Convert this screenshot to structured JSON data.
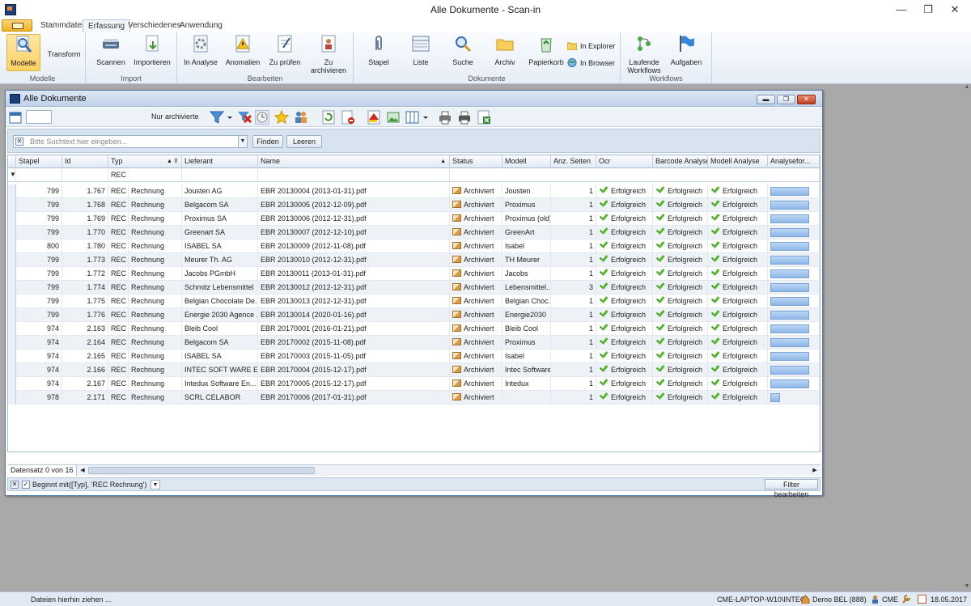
{
  "window": {
    "title": "Alle Dokumente - Scan-in",
    "minimize": "—",
    "restore": "❐",
    "close": "✕"
  },
  "tabs": [
    "Stammdaten",
    "Erfassung",
    "Verschiedenes",
    "Anwendung"
  ],
  "ribbon": {
    "groups": {
      "modelle": "Modelle",
      "import": "Import",
      "bearbeiten": "Bearbeiten",
      "dokumente": "Dokumente",
      "workflows": "Workflows"
    },
    "buttons": {
      "modelle": "Modelle",
      "transform": "Transform",
      "scannen": "Scannen",
      "importieren": "Importieren",
      "in_analyse": "In Analyse",
      "anomalien": "Anomalien",
      "zu_pruefen": "Zu prüfen",
      "zu_archivieren_1": "Zu",
      "zu_archivieren_2": "archivieren",
      "stapel": "Stapel",
      "liste": "Liste",
      "suche": "Suche",
      "archiv": "Archiv",
      "papierkorb": "Papierkorb",
      "in_explorer": "In Explorer",
      "in_browser": "In Browser",
      "laufende_1": "Laufende",
      "laufende_2": "Workflows",
      "aufgaben": "Aufgaben"
    }
  },
  "mdi": {
    "title": "Alle Dokumente"
  },
  "toolbar": {
    "nur_archivierte": "Nur archivierte"
  },
  "search": {
    "placeholder": "Bitte Suchtext hier eingeben...",
    "finden": "Finden",
    "leeren": "Leeren"
  },
  "grid": {
    "columns": [
      "Stapel",
      "Id",
      "Typ",
      "Lieferant",
      "Name",
      "Status",
      "Modell",
      "Anz. Seiten",
      "Ocr",
      "Barcode Analyse",
      "Modell Analyse",
      "Analysefor..."
    ],
    "filter_typ": "REC",
    "rows": [
      {
        "stapel": "799",
        "id": "1.767",
        "typ": "REC",
        "sub": "Rechnung",
        "lieferant": "Jousten AG",
        "name": "EBR 20130004 (2013-01-31).pdf",
        "status": "Archiviert",
        "modell": "Jousten",
        "seiten": "1",
        "ocr": "Erfolgreich",
        "barcode": "Erfolgreich",
        "modellanalyse": "Erfolgreich",
        "progress": 1.0
      },
      {
        "stapel": "799",
        "id": "1.768",
        "typ": "REC",
        "sub": "Rechnung",
        "lieferant": "Belgacom SA",
        "name": "EBR 20130005 (2012-12-09).pdf",
        "status": "Archiviert",
        "modell": "Proximus",
        "seiten": "1",
        "ocr": "Erfolgreich",
        "barcode": "Erfolgreich",
        "modellanalyse": "Erfolgreich",
        "progress": 1.0
      },
      {
        "stapel": "799",
        "id": "1.769",
        "typ": "REC",
        "sub": "Rechnung",
        "lieferant": "Proximus SA",
        "name": "EBR 20130006 (2012-12-31).pdf",
        "status": "Archiviert",
        "modell": "Proximus (old)",
        "seiten": "1",
        "ocr": "Erfolgreich",
        "barcode": "Erfolgreich",
        "modellanalyse": "Erfolgreich",
        "progress": 1.0
      },
      {
        "stapel": "799",
        "id": "1.770",
        "typ": "REC",
        "sub": "Rechnung",
        "lieferant": "Greenart SA",
        "name": "EBR 20130007 (2012-12-10).pdf",
        "status": "Archiviert",
        "modell": "GreenArt",
        "seiten": "1",
        "ocr": "Erfolgreich",
        "barcode": "Erfolgreich",
        "modellanalyse": "Erfolgreich",
        "progress": 1.0
      },
      {
        "stapel": "800",
        "id": "1.780",
        "typ": "REC",
        "sub": "Rechnung",
        "lieferant": "ISABEL SA",
        "name": "EBR 20130009 (2012-11-08).pdf",
        "status": "Archiviert",
        "modell": "Isabel",
        "seiten": "1",
        "ocr": "Erfolgreich",
        "barcode": "Erfolgreich",
        "modellanalyse": "Erfolgreich",
        "progress": 1.0
      },
      {
        "stapel": "799",
        "id": "1.773",
        "typ": "REC",
        "sub": "Rechnung",
        "lieferant": "Meurer Th. AG",
        "name": "EBR 20130010 (2012-12-31).pdf",
        "status": "Archiviert",
        "modell": "TH Meurer",
        "seiten": "1",
        "ocr": "Erfolgreich",
        "barcode": "Erfolgreich",
        "modellanalyse": "Erfolgreich",
        "progress": 1.0
      },
      {
        "stapel": "799",
        "id": "1.772",
        "typ": "REC",
        "sub": "Rechnung",
        "lieferant": "Jacobs PGmbH",
        "name": "EBR 20130011 (2013-01-31).pdf",
        "status": "Archiviert",
        "modell": "Jacobs",
        "seiten": "1",
        "ocr": "Erfolgreich",
        "barcode": "Erfolgreich",
        "modellanalyse": "Erfolgreich",
        "progress": 1.0
      },
      {
        "stapel": "799",
        "id": "1.774",
        "typ": "REC",
        "sub": "Rechnung",
        "lieferant": "Schmitz Lebensmittel",
        "name": "EBR 20130012 (2012-12-31).pdf",
        "status": "Archiviert",
        "modell": "Lebensmittel...",
        "seiten": "3",
        "ocr": "Erfolgreich",
        "barcode": "Erfolgreich",
        "modellanalyse": "Erfolgreich",
        "progress": 1.0
      },
      {
        "stapel": "799",
        "id": "1.775",
        "typ": "REC",
        "sub": "Rechnung",
        "lieferant": "Belgian Chocolate De...",
        "name": "EBR 20130013 (2012-12-31).pdf",
        "status": "Archiviert",
        "modell": "Belgian Choc...",
        "seiten": "1",
        "ocr": "Erfolgreich",
        "barcode": "Erfolgreich",
        "modellanalyse": "Erfolgreich",
        "progress": 1.0
      },
      {
        "stapel": "799",
        "id": "1.776",
        "typ": "REC",
        "sub": "Rechnung",
        "lieferant": "Energie 2030 Agence ...",
        "name": "EBR 20130014 (2020-01-16).pdf",
        "status": "Archiviert",
        "modell": "Energie2030",
        "seiten": "1",
        "ocr": "Erfolgreich",
        "barcode": "Erfolgreich",
        "modellanalyse": "Erfolgreich",
        "progress": 1.0
      },
      {
        "stapel": "974",
        "id": "2.163",
        "typ": "REC",
        "sub": "Rechnung",
        "lieferant": "Bleib Cool",
        "name": "EBR 20170001 (2016-01-21).pdf",
        "status": "Archiviert",
        "modell": "Bleib Cool",
        "seiten": "1",
        "ocr": "Erfolgreich",
        "barcode": "Erfolgreich",
        "modellanalyse": "Erfolgreich",
        "progress": 1.0
      },
      {
        "stapel": "974",
        "id": "2.164",
        "typ": "REC",
        "sub": "Rechnung",
        "lieferant": "Belgacom SA",
        "name": "EBR 20170002 (2015-11-08).pdf",
        "status": "Archiviert",
        "modell": "Proximus",
        "seiten": "1",
        "ocr": "Erfolgreich",
        "barcode": "Erfolgreich",
        "modellanalyse": "Erfolgreich",
        "progress": 1.0
      },
      {
        "stapel": "974",
        "id": "2.165",
        "typ": "REC",
        "sub": "Rechnung",
        "lieferant": "ISABEL SA",
        "name": "EBR 20170003 (2015-11-05).pdf",
        "status": "Archiviert",
        "modell": "Isabel",
        "seiten": "1",
        "ocr": "Erfolgreich",
        "barcode": "Erfolgreich",
        "modellanalyse": "Erfolgreich",
        "progress": 1.0
      },
      {
        "stapel": "974",
        "id": "2.166",
        "typ": "REC",
        "sub": "Rechnung",
        "lieferant": "INTEC SOFT WARE E...",
        "name": "EBR 20170004 (2015-12-17).pdf",
        "status": "Archiviert",
        "modell": "Intec Software",
        "seiten": "1",
        "ocr": "Erfolgreich",
        "barcode": "Erfolgreich",
        "modellanalyse": "Erfolgreich",
        "progress": 1.0
      },
      {
        "stapel": "974",
        "id": "2.167",
        "typ": "REC",
        "sub": "Rechnung",
        "lieferant": "Intedux Software En...",
        "name": "EBR 20170005 (2015-12-17).pdf",
        "status": "Archiviert",
        "modell": "Intedux",
        "seiten": "1",
        "ocr": "Erfolgreich",
        "barcode": "Erfolgreich",
        "modellanalyse": "Erfolgreich",
        "progress": 1.0
      },
      {
        "stapel": "978",
        "id": "2.171",
        "typ": "REC",
        "sub": "Rechnung",
        "lieferant": "SCRL CELABOR",
        "name": "EBR 20170006 (2017-01-31).pdf",
        "status": "Archiviert",
        "modell": "",
        "seiten": "1",
        "ocr": "Erfolgreich",
        "barcode": "Erfolgreich",
        "modellanalyse": "Erfolgreich",
        "progress": 0.25
      }
    ]
  },
  "footer": {
    "datensatz": "Datensatz 0 von 16",
    "filter_expr": "Beginnt mit([Typ], 'REC   Rechnung')",
    "filter_bearbeiten": "Filter bearbeiten"
  },
  "statusbar": {
    "drop": "Dateien hierhin ziehen ...",
    "machine": "CME-LAPTOP-W10\\INTEC",
    "company": "Demo BEL (888)",
    "user": "CME",
    "date": "18.05.2017"
  }
}
